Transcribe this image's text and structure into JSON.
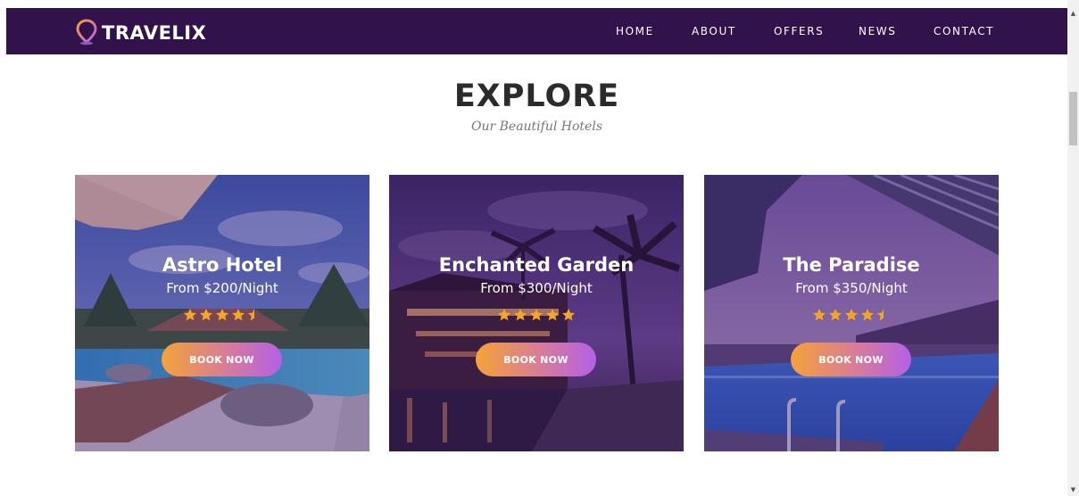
{
  "nav": {
    "logo_text": "TRAVELIX",
    "items": [
      {
        "label": "HOME"
      },
      {
        "label": "ABOUT"
      },
      {
        "label": "OFFERS"
      },
      {
        "label": "NEWS"
      },
      {
        "label": "CONTACT"
      }
    ]
  },
  "section": {
    "title": "EXPLORE",
    "subtitle": "Our Beautiful Hotels"
  },
  "hotels": [
    {
      "name": "Astro Hotel",
      "price": "From $200/Night",
      "rating": 4.5,
      "button_label": "BOOK NOW"
    },
    {
      "name": "Enchanted Garden",
      "price": "From $300/Night",
      "rating": 5,
      "button_label": "BOOK NOW"
    },
    {
      "name": "The Paradise",
      "price": "From $350/Night",
      "rating": 4.5,
      "button_label": "BOOK NOW"
    }
  ],
  "colors": {
    "nav_background": "#31124b",
    "star": "#f5a623",
    "button_gradient_start": "#f4a338",
    "button_gradient_end": "#b360e6",
    "heading_text": "#2b2b2b"
  },
  "icons": {
    "logo": "location-pin-icon",
    "rating": "star-icon",
    "scroll_up": "arrow-up-icon",
    "scroll_down": "arrow-down-icon"
  }
}
